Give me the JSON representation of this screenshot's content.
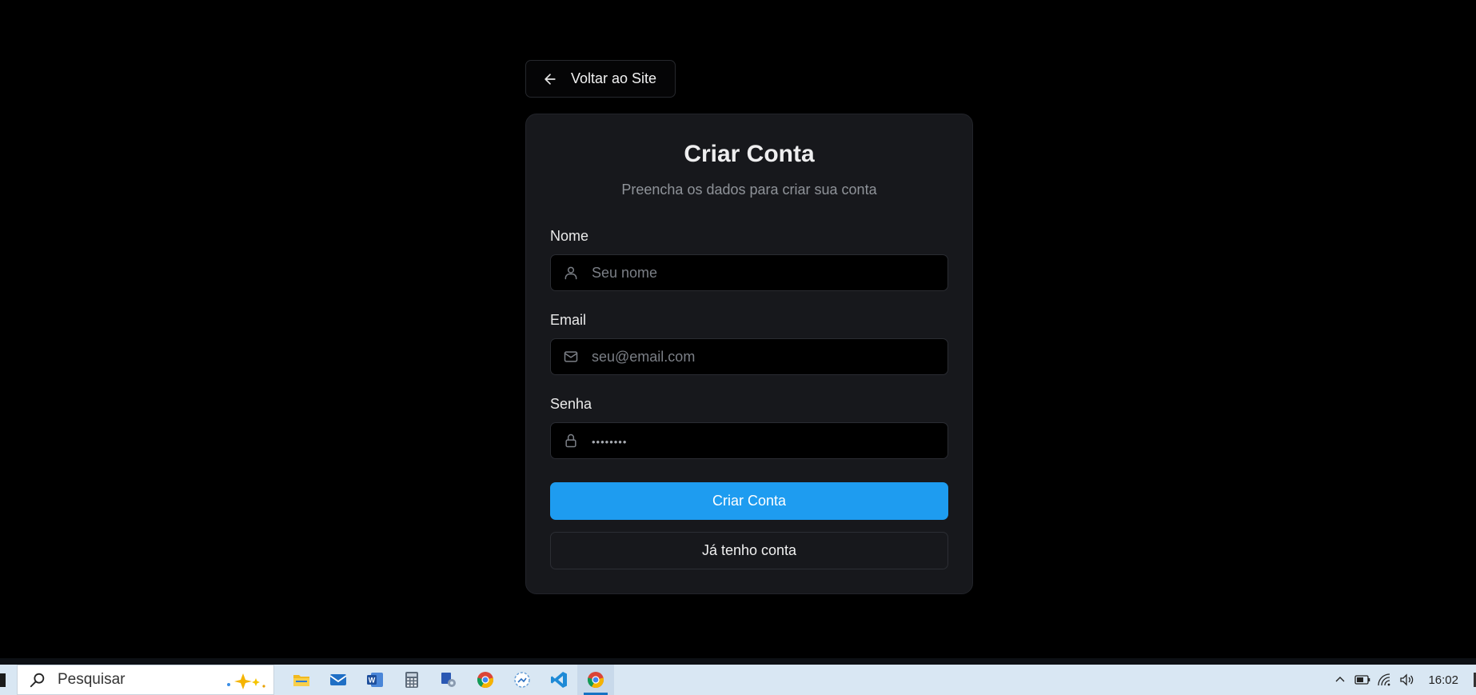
{
  "back_button": {
    "label": "Voltar ao Site",
    "icon": "arrow-left-icon"
  },
  "card": {
    "title": "Criar Conta",
    "subtitle": "Preencha os dados para criar sua conta",
    "fields": [
      {
        "label": "Nome",
        "placeholder": "Seu nome",
        "icon": "user-icon",
        "type": "text"
      },
      {
        "label": "Email",
        "placeholder": "seu@email.com",
        "icon": "mail-icon",
        "type": "email"
      },
      {
        "label": "Senha",
        "placeholder": "••••••••",
        "icon": "lock-icon",
        "type": "password"
      }
    ],
    "submit_label": "Criar Conta",
    "login_label": "Já tenho conta"
  },
  "colors": {
    "background": "#000000",
    "card": "#17181c",
    "primary": "#1e9cf0",
    "muted_text": "#8f9399"
  },
  "taskbar": {
    "search_placeholder": "Pesquisar",
    "apps": [
      "file-explorer-icon",
      "mail-icon",
      "word-icon",
      "calculator-icon",
      "app-icon",
      "chrome-icon",
      "photos-icon",
      "vscode-icon",
      "chrome-icon"
    ],
    "active_app_index": 8,
    "tray_icons": [
      "chevron-up-icon",
      "battery-icon",
      "wifi-icon",
      "volume-icon"
    ],
    "clock": "16:02"
  }
}
